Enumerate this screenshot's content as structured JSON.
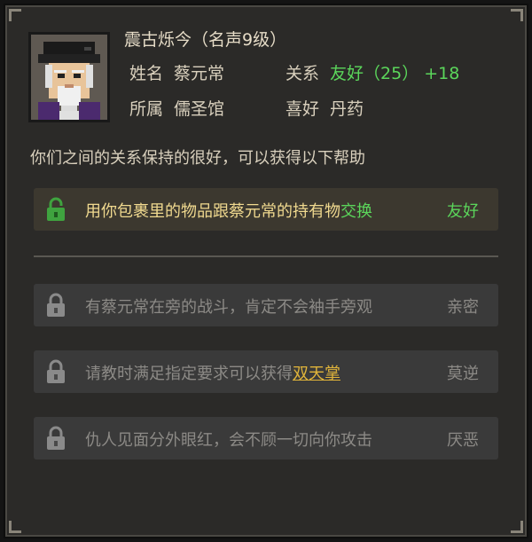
{
  "header": {
    "title": "震古烁今（名声9级）",
    "name_label": "姓名",
    "name_value": "蔡元常",
    "relation_label": "关系",
    "relation_value": "友好（25）",
    "relation_delta": "+18",
    "faction_label": "所属",
    "faction_value": "儒圣馆",
    "hobby_label": "喜好",
    "hobby_value": "丹药"
  },
  "subtitle": "你们之间的关系保持的很好，可以获得以下帮助",
  "rows": [
    {
      "text_before": "用你包裹里的物品跟蔡元常的持有物",
      "highlight": "交换",
      "text_after": "",
      "level": "友好",
      "locked": false
    },
    {
      "text_before": "有蔡元常在旁的战斗，肯定不会袖手旁观",
      "highlight": "",
      "text_after": "",
      "level": "亲密",
      "locked": true
    },
    {
      "text_before": "请教时满足指定要求可以获得",
      "highlight": "双天掌",
      "text_after": "",
      "level": "莫逆",
      "locked": true
    },
    {
      "text_before": "仇人见面分外眼红，会不顾一切向你攻击",
      "highlight": "",
      "text_after": "",
      "level": "厌恶",
      "locked": true
    }
  ],
  "colors": {
    "unlocked_lock": "#3fa33f",
    "locked_lock": "#8a8a8a",
    "friendly": "#5bd65b",
    "gold": "#e0b43a"
  },
  "icons": [
    "character-portrait",
    "unlocked-padlock-icon",
    "locked-padlock-icon"
  ]
}
